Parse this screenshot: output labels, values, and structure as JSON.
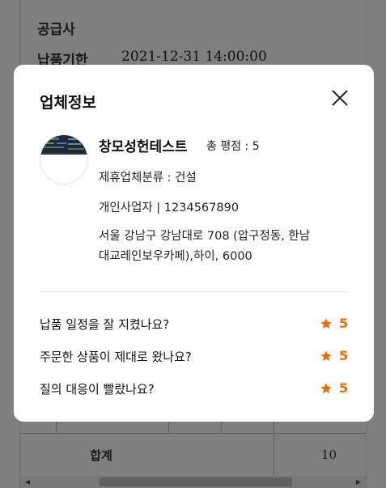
{
  "background": {
    "supplier_label": "공급사",
    "deadline_label": "납품기한",
    "deadline_value": "2021-12-31 14:00:00",
    "total_label": "합계",
    "total_value": "10"
  },
  "modal": {
    "title": "업체정보",
    "close_icon": "close-icon",
    "company": {
      "name": "창모성헌테스트",
      "rating_total": "총 평점 : 5",
      "category": "제휴업체분류 : 건설",
      "business_info": "개인사업자 | 1234567890",
      "address_line1": "서울 강남구 강남대로 708 (압구정동, 한남",
      "address_line2": "대교레인보우카페),하이, 6000"
    },
    "reviews": [
      {
        "question": "납품 일정을 잘 지켰나요?",
        "score": "5",
        "icon": "star-icon"
      },
      {
        "question": "주문한 상품이 제대로 왔나요?",
        "score": "5",
        "icon": "star-icon"
      },
      {
        "question": "질의 대응이 빨랐나요?",
        "score": "5",
        "icon": "star-icon"
      }
    ]
  },
  "colors": {
    "accent": "#f26b00",
    "overlay": "rgba(0,0,0,0.5)",
    "text": "#111111"
  }
}
